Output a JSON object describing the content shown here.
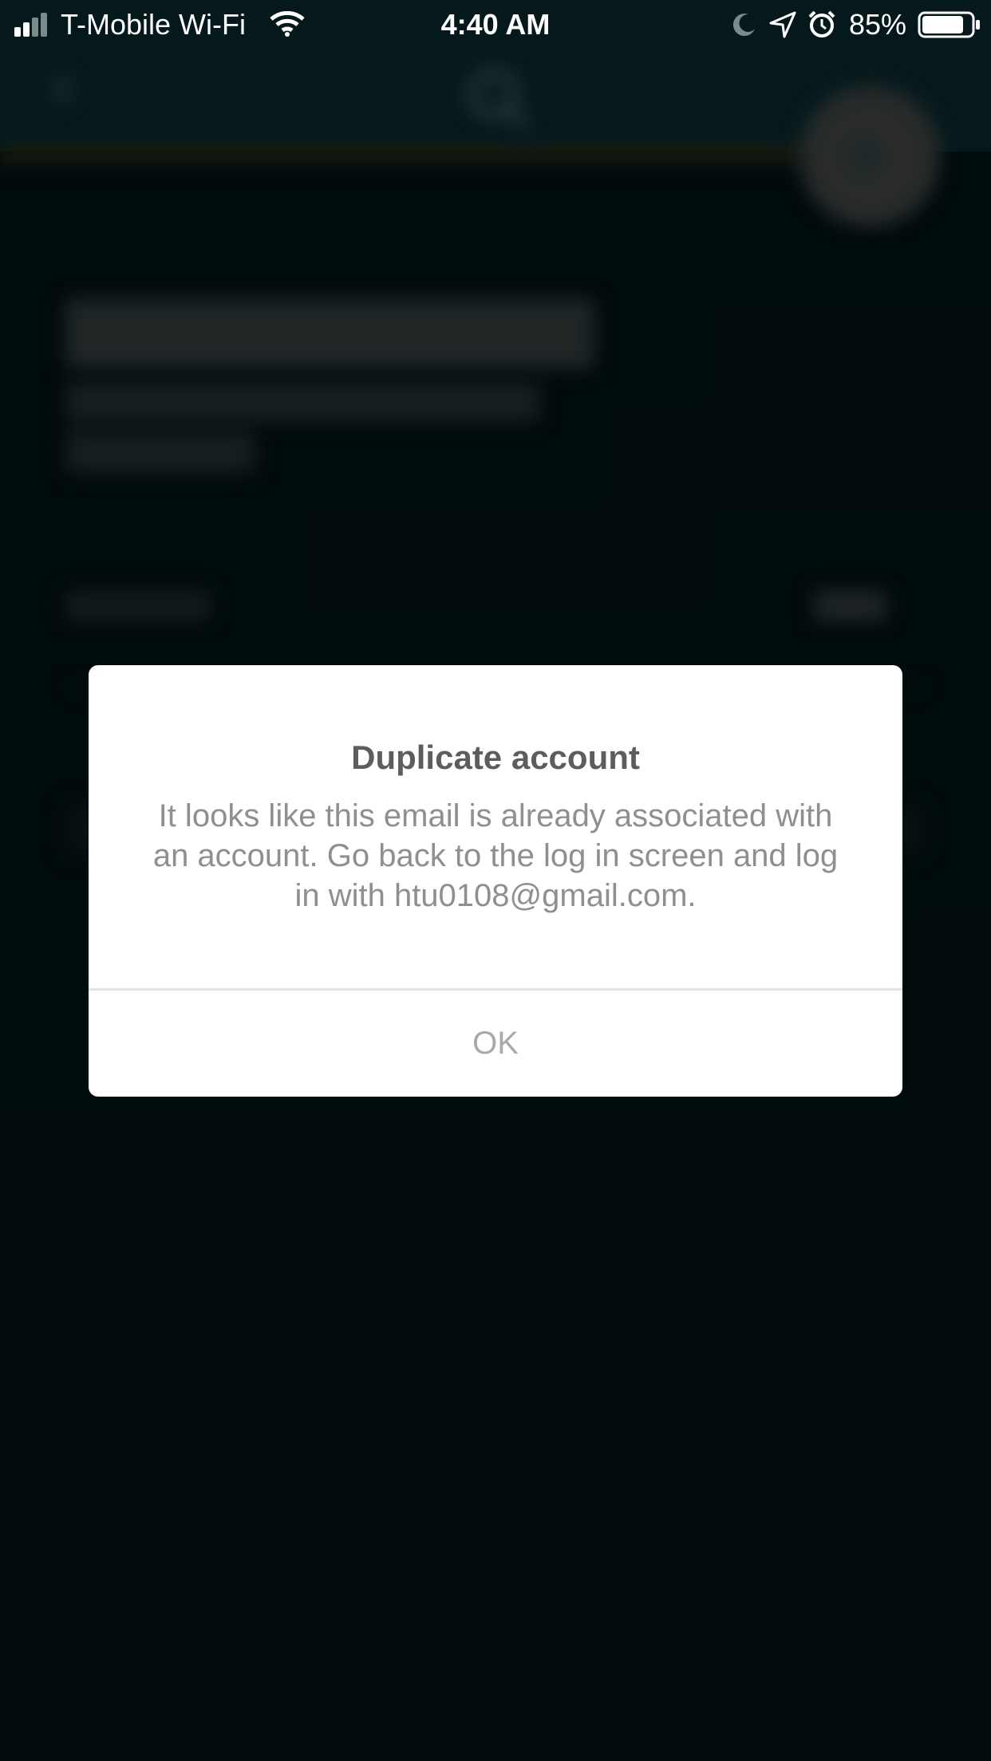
{
  "status_bar": {
    "carrier": "T-Mobile Wi-Fi",
    "time": "4:40 AM",
    "battery_percent": "85%",
    "battery_level": 0.85,
    "icons": [
      "signal-icon",
      "wifi-icon",
      "moon-icon",
      "location-icon",
      "alarm-icon",
      "battery-icon"
    ]
  },
  "background_screen": {
    "header_icons": [
      "back-icon",
      "logo-icon",
      "next-arrow-icon"
    ],
    "colors": {
      "header": "#0a2e33",
      "body": "#011418",
      "accent": "#3c3a14"
    }
  },
  "dialog": {
    "title": "Duplicate account",
    "message": "It looks like this email is already associated with an account. Go back to the log in screen and log in with htu0108@gmail.com.",
    "ok_label": "OK"
  }
}
